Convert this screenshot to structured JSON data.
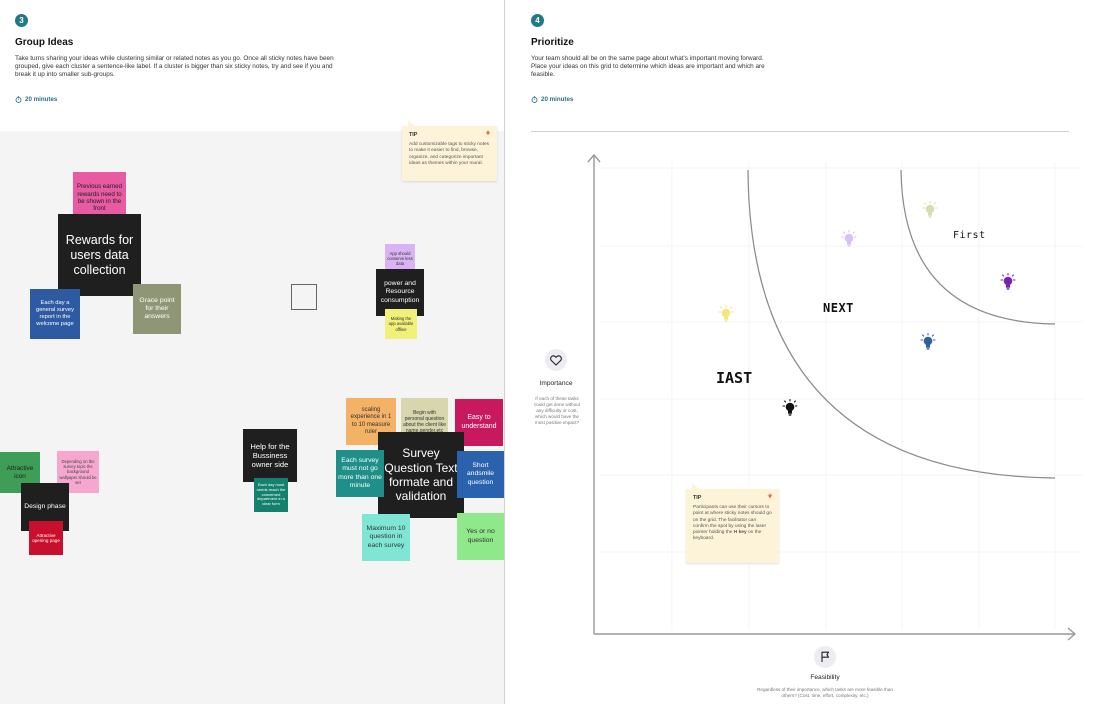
{
  "group_ideas": {
    "step": "3",
    "title": "Group Ideas",
    "description": "Take turns sharing your ideas while clustering similar or related notes as you go. Once all sticky notes have been grouped, give each cluster a sentence-like label. If a cluster is bigger than six sticky notes, try and see if you and break it up into smaller sub-groups.",
    "timer": "20 minutes",
    "tip": {
      "title": "TIP",
      "body": "Add customizable tags to sticky notes to make it easier to find, browse, organize, and categorize important ideas as themes within your mural."
    }
  },
  "prioritize": {
    "step": "4",
    "title": "Prioritize",
    "description": "Your team should all be on the same page about what's important moving forward. Place your ideas on this grid to determine which ideas are important and which are feasible.",
    "timer": "20 minutes",
    "tip": {
      "title": "TIP",
      "body_pre": "Participants can use their cursors to point at where sticky notes should go on the grid. The facilitator can confirm the spot by using the laser pointer holding the ",
      "body_key": "H key",
      "body_post": " on the keyboard."
    },
    "importance": {
      "label": "Importance",
      "sub": "If each of these tasks could get done without any difficulty or cost, which would have the most positive impact?"
    },
    "feasibility": {
      "label": "Feasibility",
      "sub": "Regardless of their importance, which tasks are more feasible than others? (Cost, time, effort, complexity, etc.)"
    },
    "zones": {
      "first": "First",
      "next": "NEXT",
      "last": "IAST"
    },
    "bulb_colors": [
      "#d6dcb4",
      "#d9c2f2",
      "#7a1fb8",
      "#f5e67a",
      "#2b5fa8",
      "#111111"
    ]
  },
  "notes": [
    {
      "id": "previous-earned",
      "text": "Previous earned rewards need to be shown in the front",
      "bg": "#e85aa2",
      "fg": "#222222"
    },
    {
      "id": "rewards-for-users",
      "text": "Rewards for users data collection",
      "bg": "#1f1f1f",
      "fg": "#ffffff"
    },
    {
      "id": "each-day-survey",
      "text": "Each day a general survey report in the welcome page",
      "bg": "#2d5aa0",
      "fg": "#ffffff"
    },
    {
      "id": "grace-point",
      "text": "Grace point for their answers",
      "bg": "#8f9676",
      "fg": "#ffffff"
    },
    {
      "id": "app-conserve",
      "text": "App should conserve less data",
      "bg": "#d9b3f2",
      "fg": "#333333"
    },
    {
      "id": "power-resource",
      "text": "power and Resource consumption",
      "bg": "#1f1f1f",
      "fg": "#ffffff"
    },
    {
      "id": "making-app-offline",
      "text": "Making the app available offline",
      "bg": "#f1f079",
      "fg": "#333333"
    },
    {
      "id": "scaling-experience",
      "text": "scaling experience in 1 to 10 measure ruler",
      "bg": "#f4b266",
      "fg": "#333333"
    },
    {
      "id": "begin-personal",
      "text": "Begin with personal question about the client like name,gender,etc",
      "bg": "#d8d6ad",
      "fg": "#333333"
    },
    {
      "id": "easy-understand",
      "text": "Easy to understand",
      "bg": "#c8195e",
      "fg": "#ffffff"
    },
    {
      "id": "help-business",
      "text": "Help for the Bussiness owner side",
      "bg": "#1f1f1f",
      "fg": "#ffffff"
    },
    {
      "id": "each-day-must",
      "text": "Each day must needs reach the concerned department in a clear form",
      "bg": "#15806e",
      "fg": "#ffffff"
    },
    {
      "id": "each-survey-one-minute",
      "text": "Each survey must not go more than one minute",
      "bg": "#1f8f8a",
      "fg": "#ffffff"
    },
    {
      "id": "survey-question",
      "text": "Survey Question Text formate and validation",
      "bg": "#1f1f1f",
      "fg": "#ffffff"
    },
    {
      "id": "short-smile",
      "text": "Short andsmile question",
      "bg": "#2a62ad",
      "fg": "#ffffff"
    },
    {
      "id": "maximum-10",
      "text": "Maximum 10 question in each survey",
      "bg": "#7fe6d6",
      "fg": "#333333"
    },
    {
      "id": "yes-or-no",
      "text": "Yes or no question",
      "bg": "#8fe88a",
      "fg": "#333333"
    },
    {
      "id": "attractive-icon",
      "text": "Attractive icon",
      "bg": "#3e9d56",
      "fg": "#222222"
    },
    {
      "id": "depending-survey",
      "text": "Depending on the survey topic the background wallpaper should be set",
      "bg": "#f7a6cf",
      "fg": "#444444"
    },
    {
      "id": "design-phase",
      "text": "Design phase",
      "bg": "#1f1f1f",
      "fg": "#ffffff"
    },
    {
      "id": "attractive-opening",
      "text": "Attractive opening page",
      "bg": "#c8102e",
      "fg": "#ffffff"
    }
  ]
}
